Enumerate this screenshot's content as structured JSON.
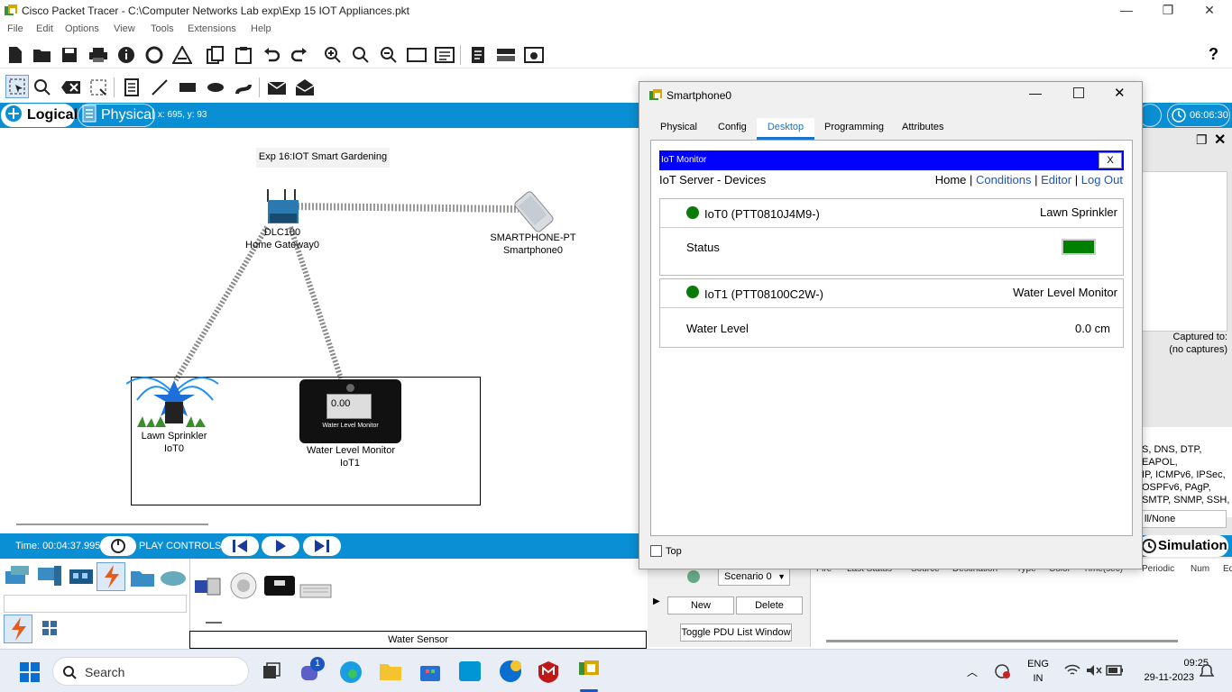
{
  "window": {
    "title": "Cisco Packet Tracer - C:\\Computer Networks Lab exp\\Exp 15 IOT Appliances.pkt",
    "min": "—",
    "max": "❐",
    "close": "✕"
  },
  "menu": [
    "File",
    "Edit",
    "Options",
    "View",
    "Tools",
    "Extensions",
    "Help"
  ],
  "help_icon": "?",
  "modebar": {
    "logical": "Logical",
    "physical": "Physical",
    "coords": "x: 695, y: 93",
    "clock": "06:06:30"
  },
  "canvas": {
    "note": "Exp 16:IOT Smart Gardening",
    "gateway_model": "DLC100",
    "gateway_name": "Home Gateway0",
    "phone_model": "SMARTPHONE-PT",
    "phone_name": "Smartphone0",
    "sprinkler_name": "Lawn Sprinkler",
    "sprinkler_id": "IoT0",
    "wlm_name": "Water Level Monitor",
    "wlm_id": "IoT1",
    "wlm_display_value": "0.00",
    "wlm_display_label": "Water Level Monitor"
  },
  "timebar": {
    "time": "Time: 00:04:37.995",
    "play_controls": "PLAY CONTROLS:"
  },
  "tray": {
    "selected_device": "Water Sensor"
  },
  "right_panel": {
    "captured_to": "Captured to:",
    "no_captures": "(no captures)",
    "protocols": [
      "S, DNS, DTP, EAPOL,",
      "IP, ICMPv6, IPSec,",
      "OSPFv6, PAgP,",
      "SMTP, SNMP, SSH,"
    ],
    "all_none": "ll/None",
    "simulation": "Simulation"
  },
  "pdu": {
    "scenario": "Scenario 0",
    "new": "New",
    "delete": "Delete",
    "toggle": "Toggle PDU List Window",
    "columns": [
      "Fire",
      "Last Status",
      "Source",
      "Destination",
      "Type",
      "Color",
      "Time(sec)",
      "Periodic",
      "Num",
      "Ed"
    ]
  },
  "dialog": {
    "title": "Smartphone0",
    "tabs": [
      "Physical",
      "Config",
      "Desktop",
      "Programming",
      "Attributes"
    ],
    "active_tab": "Desktop",
    "iot_header": "IoT Monitor",
    "iot_close": "X",
    "server_title": "IoT Server - Devices",
    "nav": {
      "home": "Home",
      "conditions": "Conditions",
      "editor": "Editor",
      "logout": "Log Out",
      "sep": "|"
    },
    "devices": [
      {
        "id": "IoT0 (PTT0810J4M9-)",
        "type": "Lawn Sprinkler",
        "prop": "Status",
        "value": "",
        "status_color": "#008000"
      },
      {
        "id": "IoT1 (PTT08100C2W-)",
        "type": "Water Level Monitor",
        "prop": "Water Level",
        "value": "0.0 cm"
      }
    ],
    "top_checkbox": "Top"
  },
  "taskbar": {
    "search": "Search",
    "lang1": "ENG",
    "lang2": "IN",
    "time": "09:25",
    "date": "29-11-2023",
    "badge": "1"
  }
}
